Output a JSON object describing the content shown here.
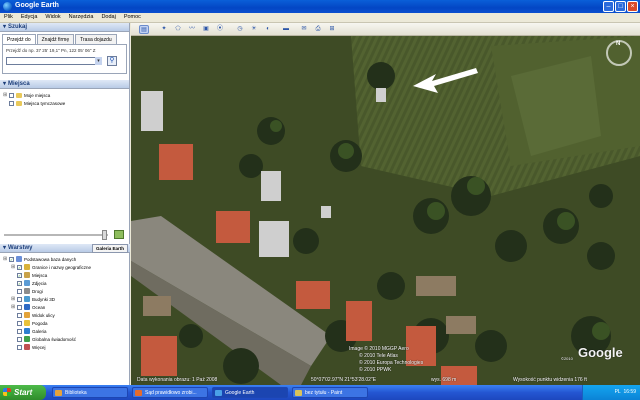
{
  "window": {
    "title": "Google Earth",
    "min": "–",
    "max": "□",
    "close": "×"
  },
  "menu": [
    "Plik",
    "Edycja",
    "Widok",
    "Narzędzia",
    "Dodaj",
    "Pomoc"
  ],
  "search": {
    "header": "Szukaj",
    "tabs": [
      "Przejdź do",
      "Znajdź firmę",
      "Trasa dojazdu"
    ],
    "hint_label": "Przejdź do",
    "hint_example": "np. 37 25' 19,1\" Pn, 122 05' 06\" Z"
  },
  "places": {
    "header": "Miejsca",
    "items": [
      "Moje miejsca",
      "Miejsca tymczasowe"
    ]
  },
  "layers": {
    "header": "Warstwy",
    "gallery_button": "Galeria Earth",
    "items": [
      {
        "label": "Podstawowa baza danych",
        "color": "#6a8fd8"
      },
      {
        "label": "Granice i nazwy geograficzne",
        "color": "#d9b23a"
      },
      {
        "label": "Miejsca",
        "color": "#c9a24a"
      },
      {
        "label": "Zdjęcia",
        "color": "#5b9bd5"
      },
      {
        "label": "Drogi",
        "color": "#8c8c8c"
      },
      {
        "label": "Budynki 3D",
        "color": "#4a9ad0"
      },
      {
        "label": "Ocean",
        "color": "#2c6ac4"
      },
      {
        "label": "Widok ulicy",
        "color": "#e3a33a"
      },
      {
        "label": "Pogoda",
        "color": "#e8c23a"
      },
      {
        "label": "Galeria",
        "color": "#2d7fd0"
      },
      {
        "label": "Globalna świadomość",
        "color": "#3fa04a"
      },
      {
        "label": "Więcej",
        "color": "#c05050"
      }
    ]
  },
  "map": {
    "copyright_1": "Image © 2010 MGGP Aero",
    "copyright_2": "© 2010 Tele Atlas",
    "copyright_3": "© 2010 Europa Technologies",
    "copyright_4": "© 2010 PPWK",
    "google_logo": "Google",
    "google_year": "©2010",
    "imagery_date": "Data wykonania obrazu: 1 Paź 2008",
    "coords": "50°07'02.97\"N    21°53'28.02\"E",
    "elevation": "wys. 698 m",
    "eye_alt": "Wysokość punktu widzenia   176 ft",
    "compass_n": "N"
  },
  "taskbar": {
    "start": "Start",
    "tasks": [
      {
        "label": "Biblioteka",
        "color": "#e8a23a"
      },
      {
        "label": "Sąd prawidłowo zrobi...",
        "color": "#e66b2c"
      },
      {
        "label": "Google Earth",
        "color": "#4aa0e8"
      },
      {
        "label": "bez tytułu - Paint",
        "color": "#d9c25a"
      }
    ],
    "tray": "PL",
    "clock": "16:59"
  }
}
